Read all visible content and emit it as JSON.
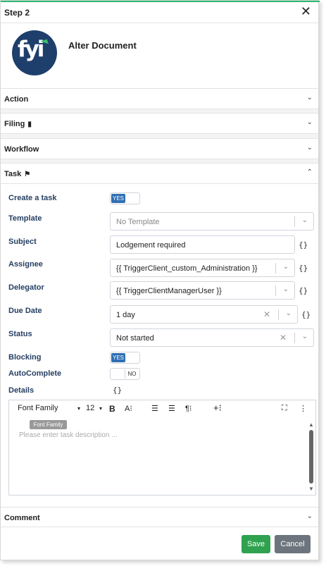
{
  "header": {
    "title": "Step 2",
    "close_icon": "close-icon"
  },
  "logo": {
    "text": "fyi",
    "color": "#1e3f6b",
    "accent": "#3dbb6f"
  },
  "document": {
    "title": "Alter Document"
  },
  "sections": {
    "action": "Action",
    "filing": "Filing",
    "workflow": "Workflow",
    "task": "Task",
    "comment": "Comment"
  },
  "task": {
    "create_label": "Create a task",
    "create_value": "YES",
    "template_label": "Template",
    "template_placeholder": "No Template",
    "subject_label": "Subject",
    "subject_value": "Lodgement required",
    "assignee_label": "Assignee",
    "assignee_value": "{{ TriggerClient_custom_Administration }}",
    "delegator_label": "Delegator",
    "delegator_value": "{{ TriggerClientManagerUser }}",
    "due_label": "Due Date",
    "due_value": "1 day",
    "status_label": "Status",
    "status_value": "Not started",
    "blocking_label": "Blocking",
    "blocking_value": "YES",
    "autocomplete_label": "AutoComplete",
    "autocomplete_value": "NO",
    "details_label": "Details",
    "braces": "{}"
  },
  "editor": {
    "font_family": "Font Family",
    "font_size": "12",
    "tooltip": "Font Family",
    "placeholder": "Please enter task description ..."
  },
  "footer": {
    "save": "Save",
    "cancel": "Cancel"
  },
  "colors": {
    "primary": "#2f6fb3",
    "save": "#2fa24f",
    "cancel": "#6c757d",
    "label": "#263f63"
  }
}
